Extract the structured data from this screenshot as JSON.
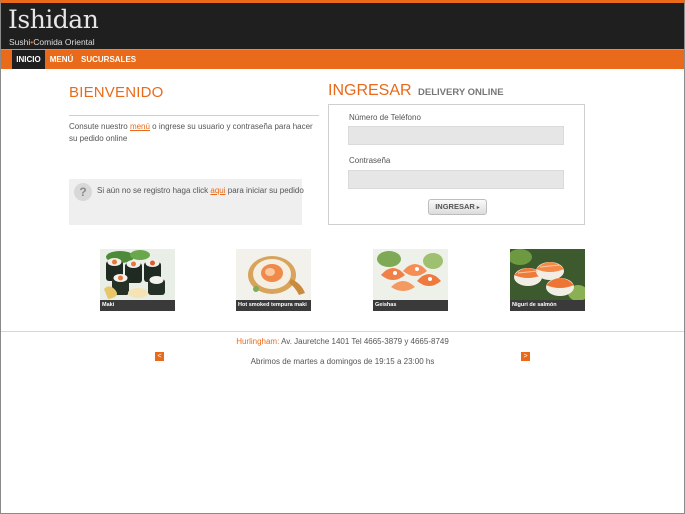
{
  "brand": {
    "name": "Ishidan",
    "tagline_left": "Sushi",
    "tagline_sep": "•",
    "tagline_right": "Comida Oriental"
  },
  "nav": {
    "items": [
      {
        "label": "INICIO",
        "active": true
      },
      {
        "label": "MENÚ",
        "active": false
      },
      {
        "label": "SUCURSALES",
        "active": false
      }
    ]
  },
  "welcome": {
    "title": "BIENVENIDO",
    "text_before": "Consute nuestro ",
    "menu_link": "menú",
    "text_after": " o ingrese su usuario y contraseña para hacer su pedido online",
    "register_before": "Si aún no se registro haga click ",
    "register_link": "aqui",
    "register_after": " para iniciar su pedido",
    "help_icon": "question-icon",
    "help_glyph": "?"
  },
  "login": {
    "title": "INGRESAR",
    "subtitle": "DELIVERY ONLINE",
    "phone_label": "Número de Teléfono",
    "phone_value": "",
    "password_label": "Contraseña",
    "password_value": "",
    "button_label": "INGRESAR",
    "button_icon": "▸"
  },
  "dishes": [
    {
      "caption": "Maki"
    },
    {
      "caption": "Hot smoked tempura maki"
    },
    {
      "caption": "Geishas"
    },
    {
      "caption": "Niguri de salmón"
    }
  ],
  "footer": {
    "city": "Hurlingham:",
    "address": " Av. Jauretche 1401 Tel 4665-3879 y 4665-8749",
    "hours": "Abrimos de martes a domingos de 19:15 a 23:00 hs",
    "prev_glyph": "<",
    "next_glyph": ">"
  },
  "colors": {
    "accent": "#e86a1a",
    "header_bg": "#1f1f1f",
    "panel_bg": "#efefef"
  }
}
